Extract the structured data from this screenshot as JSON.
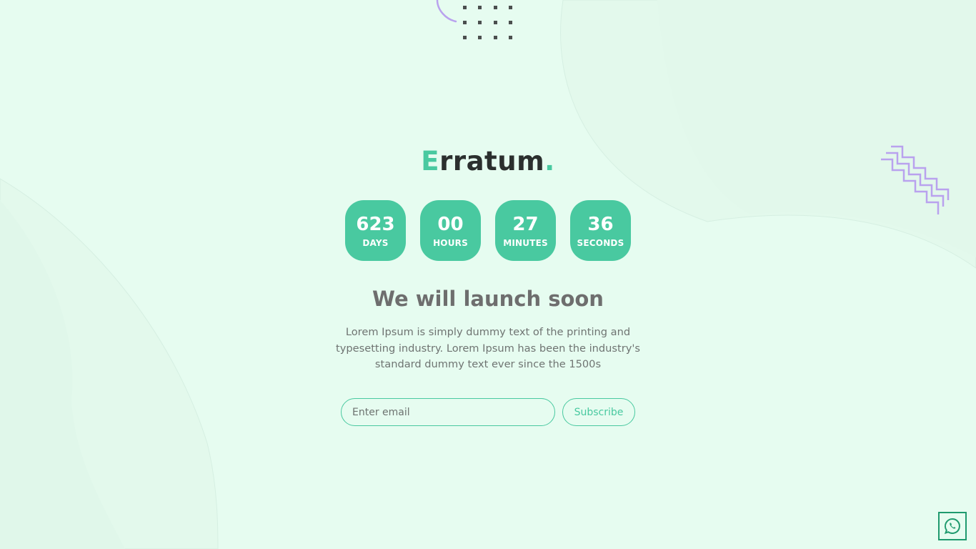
{
  "brand": {
    "first_letter": "E",
    "rest": "rratum",
    "dot": "."
  },
  "countdown": [
    {
      "value": "623",
      "label": "DAYS"
    },
    {
      "value": "00",
      "label": "HOURS"
    },
    {
      "value": "27",
      "label": "MINUTES"
    },
    {
      "value": "36",
      "label": "SECONDS"
    }
  ],
  "headline": "We will launch soon",
  "description": "Lorem Ipsum is simply dummy text of the printing and typesetting industry. Lorem Ipsum has been the industry's standard dummy text ever since the 1500s",
  "subscribe": {
    "placeholder": "Enter email",
    "button_label": "Subscribe"
  },
  "floating": {
    "whatsapp_icon": "whatsapp-icon"
  },
  "colors": {
    "background": "#e6fcf0",
    "accent": "#49c9a0",
    "decor_purple": "#b9a2ee",
    "text_dark": "#2b2f2e",
    "text_muted": "#6e6e6e"
  }
}
